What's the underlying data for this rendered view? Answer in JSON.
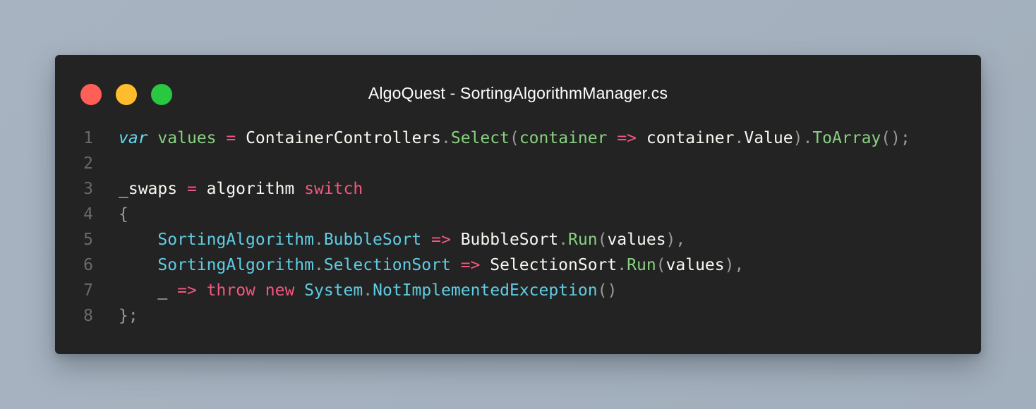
{
  "window": {
    "title": "AlgoQuest - SortingAlgorithmManager.cs",
    "controls": {
      "close_color": "#ff5f57",
      "minimize_color": "#ffbd2e",
      "zoom_color": "#28c840"
    }
  },
  "editor": {
    "lines": [
      {
        "number": "1",
        "tokens": [
          {
            "text": "var",
            "kind": "keyword"
          },
          {
            "text": " ",
            "kind": "text"
          },
          {
            "text": "values",
            "kind": "ident-green"
          },
          {
            "text": " ",
            "kind": "text"
          },
          {
            "text": "=",
            "kind": "operator"
          },
          {
            "text": " ContainerControllers",
            "kind": "text"
          },
          {
            "text": ".",
            "kind": "punct"
          },
          {
            "text": "Select",
            "kind": "ident-green"
          },
          {
            "text": "(",
            "kind": "punct"
          },
          {
            "text": "container",
            "kind": "ident-green"
          },
          {
            "text": " ",
            "kind": "text"
          },
          {
            "text": "=>",
            "kind": "operator"
          },
          {
            "text": " container",
            "kind": "text"
          },
          {
            "text": ".",
            "kind": "punct"
          },
          {
            "text": "Value",
            "kind": "text"
          },
          {
            "text": ")",
            "kind": "punct"
          },
          {
            "text": ".",
            "kind": "punct"
          },
          {
            "text": "ToArray",
            "kind": "ident-green"
          },
          {
            "text": "();",
            "kind": "punct"
          }
        ]
      },
      {
        "number": "2",
        "tokens": []
      },
      {
        "number": "3",
        "tokens": [
          {
            "text": "_swaps ",
            "kind": "text"
          },
          {
            "text": "=",
            "kind": "operator"
          },
          {
            "text": " algorithm ",
            "kind": "text"
          },
          {
            "text": "switch",
            "kind": "keyword-pink"
          }
        ]
      },
      {
        "number": "4",
        "tokens": [
          {
            "text": "{",
            "kind": "punct"
          }
        ]
      },
      {
        "number": "5",
        "tokens": [
          {
            "text": "    ",
            "kind": "text"
          },
          {
            "text": "SortingAlgorithm",
            "kind": "type"
          },
          {
            "text": ".",
            "kind": "punct"
          },
          {
            "text": "BubbleSort",
            "kind": "type"
          },
          {
            "text": " ",
            "kind": "text"
          },
          {
            "text": "=>",
            "kind": "operator"
          },
          {
            "text": " BubbleSort",
            "kind": "text"
          },
          {
            "text": ".",
            "kind": "punct"
          },
          {
            "text": "Run",
            "kind": "ident-green"
          },
          {
            "text": "(",
            "kind": "punct"
          },
          {
            "text": "values",
            "kind": "text"
          },
          {
            "text": "),",
            "kind": "punct"
          }
        ]
      },
      {
        "number": "6",
        "tokens": [
          {
            "text": "    ",
            "kind": "text"
          },
          {
            "text": "SortingAlgorithm",
            "kind": "type"
          },
          {
            "text": ".",
            "kind": "punct"
          },
          {
            "text": "SelectionSort",
            "kind": "type"
          },
          {
            "text": " ",
            "kind": "text"
          },
          {
            "text": "=>",
            "kind": "operator"
          },
          {
            "text": " SelectionSort",
            "kind": "text"
          },
          {
            "text": ".",
            "kind": "punct"
          },
          {
            "text": "Run",
            "kind": "ident-green"
          },
          {
            "text": "(",
            "kind": "punct"
          },
          {
            "text": "values",
            "kind": "text"
          },
          {
            "text": "),",
            "kind": "punct"
          }
        ]
      },
      {
        "number": "7",
        "tokens": [
          {
            "text": "    _ ",
            "kind": "text"
          },
          {
            "text": "=>",
            "kind": "operator"
          },
          {
            "text": " ",
            "kind": "text"
          },
          {
            "text": "throw",
            "kind": "keyword-pink"
          },
          {
            "text": " ",
            "kind": "text"
          },
          {
            "text": "new",
            "kind": "keyword-pink"
          },
          {
            "text": " ",
            "kind": "text"
          },
          {
            "text": "System",
            "kind": "type"
          },
          {
            "text": ".",
            "kind": "punct"
          },
          {
            "text": "NotImplementedException",
            "kind": "type"
          },
          {
            "text": "()",
            "kind": "punct"
          }
        ]
      },
      {
        "number": "8",
        "tokens": [
          {
            "text": "};",
            "kind": "punct"
          }
        ]
      }
    ]
  }
}
